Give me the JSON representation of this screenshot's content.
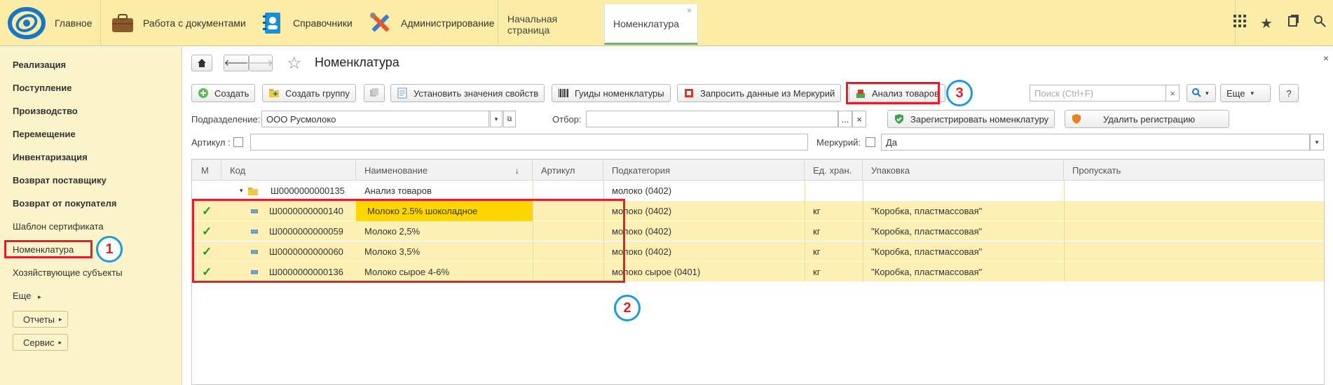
{
  "topbar": {
    "home_label": "Главное",
    "sections": [
      {
        "label": "Работа с документами",
        "icon": "briefcase-icon"
      },
      {
        "label": "Справочники",
        "icon": "address-book-icon"
      },
      {
        "label": "Администрирование",
        "icon": "tools-icon"
      }
    ],
    "tabs": [
      {
        "label": "Начальная страница"
      },
      {
        "label": "Номенклатура",
        "close": "×"
      }
    ]
  },
  "sidebar": {
    "items": [
      {
        "label": "Реализация"
      },
      {
        "label": "Поступление"
      },
      {
        "label": "Производство"
      },
      {
        "label": "Перемещение"
      },
      {
        "label": "Инвентаризация"
      },
      {
        "label": "Возврат поставщику"
      },
      {
        "label": "Возврат от покупателя"
      },
      {
        "label": "Шаблон сертификата"
      },
      {
        "label": "Номенклатура"
      },
      {
        "label": "Хозяйствующие субъекты"
      },
      {
        "label": "Еще"
      }
    ],
    "buttons": [
      {
        "label": "Отчеты"
      },
      {
        "label": "Сервис"
      }
    ]
  },
  "page": {
    "title": "Номенклатура",
    "close": "×"
  },
  "toolbar": {
    "create": "Создать",
    "create_group": "Создать группу",
    "set_props": "Установить значения свойств",
    "guides": "Гуиды номенклатуры",
    "mercury": "Запросить данные из Меркурий",
    "analysis": "Анализ товаров",
    "search_placeholder": "Поиск (Ctrl+F)",
    "more": "Еще",
    "help": "?"
  },
  "filters": {
    "division_label": "Подразделение:",
    "division_value": "ООО Русмолоко",
    "filter_label": "Отбор:",
    "filter_more": "...",
    "register": "Зарегистрировать номенклатуру",
    "unregister": "Удалить регистрацию",
    "article_label": "Артикул :",
    "mercury_label": "Меркурий:",
    "mercury_value": "Да"
  },
  "table": {
    "columns": [
      "М",
      "Код",
      "Наименование",
      "Артикул",
      "Подкатегория",
      "Ед. хран.",
      "Упаковка",
      "Пропускать"
    ],
    "sort_arrow": "↓",
    "group": {
      "code": "Ш0000000000135",
      "name": "Анализ товаров",
      "subcategory": "молоко (0402)"
    },
    "rows": [
      {
        "mark": "✓",
        "code": "Ш0000000000140",
        "name": "Молоко 2.5% шоколадное",
        "article": "",
        "subcategory": "молоко (0402)",
        "unit": "кг",
        "package": "\"Коробка, пластмассовая\"",
        "skip": ""
      },
      {
        "mark": "✓",
        "code": "Ш0000000000059",
        "name": "Молоко 2,5%",
        "article": "",
        "subcategory": "молоко (0402)",
        "unit": "кг",
        "package": "\"Коробка, пластмассовая\"",
        "skip": ""
      },
      {
        "mark": "✓",
        "code": "Ш0000000000060",
        "name": "Молоко 3,5%",
        "article": "",
        "subcategory": "молоко (0402)",
        "unit": "кг",
        "package": "\"Коробка, пластмассовая\"",
        "skip": ""
      },
      {
        "mark": "✓",
        "code": "Ш0000000000136",
        "name": "Молоко сырое 4-6%",
        "article": "",
        "subcategory": "молоко сырое (0401)",
        "unit": "кг",
        "package": "\"Коробка, пластмассовая\"",
        "skip": ""
      }
    ]
  },
  "annotations": {
    "one": "1",
    "two": "2",
    "three": "3"
  },
  "colors": {
    "accent_yellow": "#fbeda8",
    "highlight_row": "#fcf0b4",
    "selected_cell": "#ffd700",
    "annotation_red": "#e0202a",
    "annotation_blue": "#1a9be0",
    "check_green": "#1a9a2a"
  }
}
